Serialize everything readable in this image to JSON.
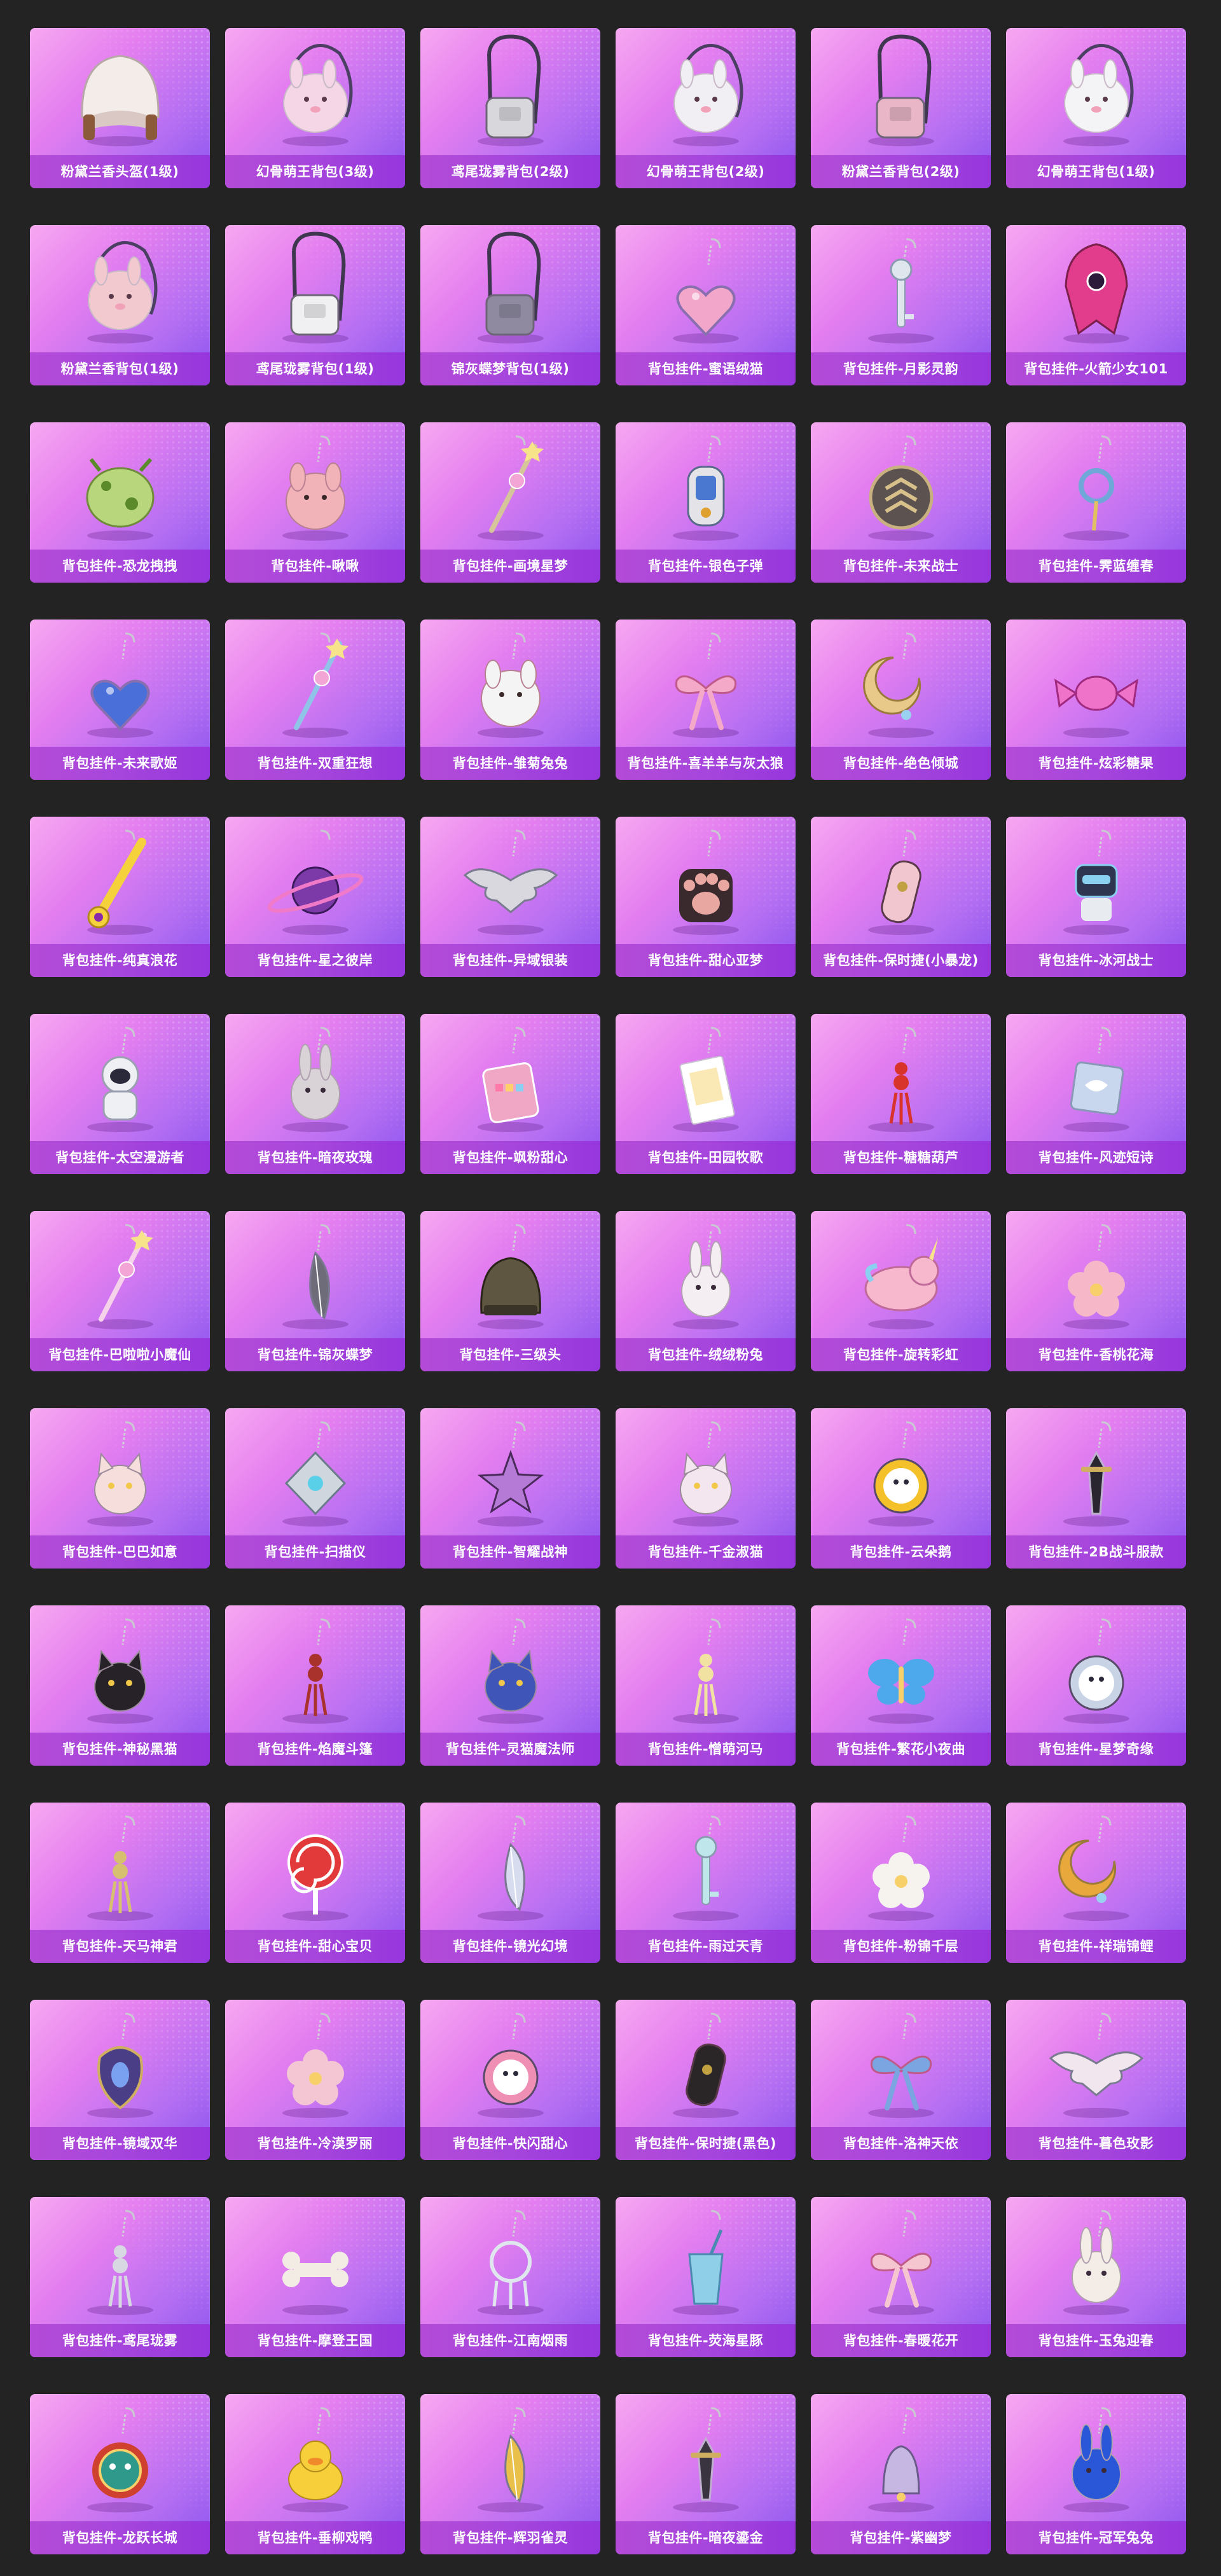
{
  "items": [
    {
      "label": "粉黛兰香头盔(1级)",
      "icon": "helmet",
      "color": "#f3ece8"
    },
    {
      "label": "幻骨萌王背包(3级)",
      "icon": "plush-backpack",
      "color": "#f4d6e6"
    },
    {
      "label": "鸢尾珑雾背包(2级)",
      "icon": "backpack",
      "color": "#d8d8dc"
    },
    {
      "label": "幻骨萌王背包(2级)",
      "icon": "plush-backpack",
      "color": "#f1eef4"
    },
    {
      "label": "粉黛兰香背包(2级)",
      "icon": "backpack",
      "color": "#e8b6c6"
    },
    {
      "label": "幻骨萌王背包(1级)",
      "icon": "plush-backpack",
      "color": "#f4f4f6"
    },
    {
      "label": "粉黛兰香背包(1级)",
      "icon": "plush-backpack",
      "color": "#f1c9cf"
    },
    {
      "label": "鸢尾珑雾背包(1级)",
      "icon": "backpack",
      "color": "#f0f0f2"
    },
    {
      "label": "锦灰蝶梦背包(1级)",
      "icon": "backpack",
      "color": "#8f8aa0"
    },
    {
      "label": "背包挂件-蜜语绒猫",
      "icon": "heart-charm",
      "color": "#f2a6c9"
    },
    {
      "label": "背包挂件-月影灵韵",
      "icon": "key-charm",
      "color": "#dfe6ee"
    },
    {
      "label": "背包挂件-火箭少女101",
      "icon": "rocket-charm",
      "color": "#e23c8c"
    },
    {
      "label": "背包挂件-恐龙拽拽",
      "icon": "egg-charm",
      "color": "#b8d67c"
    },
    {
      "label": "背包挂件-啾啾",
      "icon": "plush-charm",
      "color": "#f2b3b8"
    },
    {
      "label": "背包挂件-画境星梦",
      "icon": "wand-charm",
      "color": "#d6c49a"
    },
    {
      "label": "背包挂件-银色子弹",
      "icon": "capsule-charm",
      "color": "#e4e4e8"
    },
    {
      "label": "背包挂件-未来战士",
      "icon": "medal-charm",
      "color": "#5c5250"
    },
    {
      "label": "背包挂件-霁蓝缠春",
      "icon": "ring-charm",
      "color": "#6fa7d8"
    },
    {
      "label": "背包挂件-未来歌姬",
      "icon": "heart-charm",
      "color": "#4a6fd8"
    },
    {
      "label": "背包挂件-双重狂想",
      "icon": "wand-charm",
      "color": "#8fc4e8"
    },
    {
      "label": "背包挂件-雏菊兔兔",
      "icon": "plush-charm",
      "color": "#f4f4f4"
    },
    {
      "label": "背包挂件-喜羊羊与灰太狼",
      "icon": "bow-charm",
      "color": "#f4a9c8"
    },
    {
      "label": "背包挂件-绝色倾城",
      "icon": "moon-charm",
      "color": "#e9c98a"
    },
    {
      "label": "背包挂件-炫彩糖果",
      "icon": "candy-charm",
      "color": "#ef73c9"
    },
    {
      "label": "背包挂件-纯真浪花",
      "icon": "bottle-opener-charm",
      "color": "#f5d13b"
    },
    {
      "label": "背包挂件-星之彼岸",
      "icon": "planet-charm",
      "color": "#7c3aa8"
    },
    {
      "label": "背包挂件-异域银装",
      "icon": "wings-charm",
      "color": "#d8d8de"
    },
    {
      "label": "背包挂件-甜心亚梦",
      "icon": "paw-charm",
      "color": "#e9a7a2"
    },
    {
      "label": "背包挂件-保时捷(小暴龙)",
      "icon": "car-key-charm",
      "color": "#f2c6cf"
    },
    {
      "label": "背包挂件-冰河战士",
      "icon": "robot-charm",
      "color": "#2e3550"
    },
    {
      "label": "背包挂件-太空漫游者",
      "icon": "astronaut-charm",
      "color": "#eef0f4"
    },
    {
      "label": "背包挂件-暗夜玫瑰",
      "icon": "bunny-charm",
      "color": "#d9d3d8"
    },
    {
      "label": "背包挂件-飒粉甜心",
      "icon": "palette-charm",
      "color": "#f0a6c5"
    },
    {
      "label": "背包挂件-田园牧歌",
      "icon": "card-charm",
      "color": "#fbe9b5"
    },
    {
      "label": "背包挂件-糖糖葫芦",
      "icon": "tassel-charm",
      "color": "#d8342c"
    },
    {
      "label": "背包挂件-风迹短诗",
      "icon": "tag-charm",
      "color": "#c8d6ee"
    },
    {
      "label": "背包挂件-巴啦啦小魔仙",
      "icon": "wand-charm",
      "color": "#f5d2ea"
    },
    {
      "label": "背包挂件-锦灰蝶梦",
      "icon": "feather-charm",
      "color": "#6f6c7a"
    },
    {
      "label": "背包挂件-三级头",
      "icon": "helmet-charm",
      "color": "#5e5640"
    },
    {
      "label": "背包挂件-绒绒粉兔",
      "icon": "bunny-charm",
      "color": "#f4eef2"
    },
    {
      "label": "背包挂件-旋转彩虹",
      "icon": "unicorn-charm",
      "color": "#f7b8cd"
    },
    {
      "label": "背包挂件-香桃花海",
      "icon": "flower-charm",
      "color": "#f6b7c8"
    },
    {
      "label": "背包挂件-巴巴如意",
      "icon": "cat-charm",
      "color": "#f6dedc"
    },
    {
      "label": "背包挂件-扫描仪",
      "icon": "diamond-charm",
      "color": "#cfd6de"
    },
    {
      "label": "背包挂件-智耀战神",
      "icon": "star-charm",
      "color": "#b57ad6"
    },
    {
      "label": "背包挂件-千金淑猫",
      "icon": "cat-charm",
      "color": "#f4e6ee"
    },
    {
      "label": "背包挂件-云朵鹅",
      "icon": "round-charm",
      "color": "#f5c12a"
    },
    {
      "label": "背包挂件-2B战斗服款",
      "icon": "sword-charm",
      "color": "#2a2630"
    },
    {
      "label": "背包挂件-神秘黑猫",
      "icon": "cat-charm",
      "color": "#262228"
    },
    {
      "label": "背包挂件-焰魔斗篷",
      "icon": "tassel-charm",
      "color": "#a9322c"
    },
    {
      "label": "背包挂件-灵猫魔法师",
      "icon": "cat-charm",
      "color": "#3f56b8"
    },
    {
      "label": "背包挂件-憎萌河马",
      "icon": "tassel-charm",
      "color": "#f1e2a2"
    },
    {
      "label": "背包挂件-繁花小夜曲",
      "icon": "butterfly-charm",
      "color": "#4ea9ec"
    },
    {
      "label": "背包挂件-星梦奇缘",
      "icon": "round-charm",
      "color": "#c8d4e6"
    },
    {
      "label": "背包挂件-天马神君",
      "icon": "tassel-charm",
      "color": "#d6c070"
    },
    {
      "label": "背包挂件-甜心宝贝",
      "icon": "lollipop-charm",
      "color": "#e23a3a"
    },
    {
      "label": "背包挂件-镜光幻境",
      "icon": "feather-charm",
      "color": "#d8dcef"
    },
    {
      "label": "背包挂件-雨过天青",
      "icon": "key-charm",
      "color": "#bfe6ea"
    },
    {
      "label": "背包挂件-粉锦千层",
      "icon": "flower-charm",
      "color": "#f6f2ee"
    },
    {
      "label": "背包挂件-祥瑞锦鲤",
      "icon": "moon-charm",
      "color": "#e9a83c"
    },
    {
      "label": "背包挂件-镜域双华",
      "icon": "gem-charm",
      "color": "#4a3f86"
    },
    {
      "label": "背包挂件-冷漠罗丽",
      "icon": "flower-charm",
      "color": "#f4c6d3"
    },
    {
      "label": "背包挂件-快闪甜心",
      "icon": "round-charm",
      "color": "#ef8fb4"
    },
    {
      "label": "背包挂件-保时捷(黑色)",
      "icon": "car-key-charm",
      "color": "#2a2628"
    },
    {
      "label": "背包挂件-洛神天依",
      "icon": "bow-charm",
      "color": "#7aa5e0"
    },
    {
      "label": "背包挂件-暮色玫影",
      "icon": "wings-charm",
      "color": "#f2e6ee"
    },
    {
      "label": "背包挂件-鸢尾珑雾",
      "icon": "tassel-charm",
      "color": "#d8d8e2"
    },
    {
      "label": "背包挂件-摩登王国",
      "icon": "bone-charm",
      "color": "#f2ece4"
    },
    {
      "label": "背包挂件-江南烟雨",
      "icon": "dreamcatcher-charm",
      "color": "#dfe6ee"
    },
    {
      "label": "背包挂件-荧海星豚",
      "icon": "cup-charm",
      "color": "#8fd0e8"
    },
    {
      "label": "背包挂件-春暖花开",
      "icon": "bow-charm",
      "color": "#f6c6d0"
    },
    {
      "label": "背包挂件-玉兔迎春",
      "icon": "bunny-charm",
      "color": "#f4ece6"
    },
    {
      "label": "背包挂件-龙跃长城",
      "icon": "lion-charm",
      "color": "#2f9a8c"
    },
    {
      "label": "背包挂件-垂柳戏鸭",
      "icon": "duck-charm",
      "color": "#f6cf3a"
    },
    {
      "label": "背包挂件-辉羽雀灵",
      "icon": "feather-charm",
      "color": "#e8c04a"
    },
    {
      "label": "背包挂件-暗夜鎏金",
      "icon": "sword-charm",
      "color": "#3a3440"
    },
    {
      "label": "背包挂件-紫幽梦",
      "icon": "bell-charm",
      "color": "#c6b6e2"
    },
    {
      "label": "背包挂件-冠军兔兔",
      "icon": "bunny-charm",
      "color": "#2a56d8"
    }
  ]
}
